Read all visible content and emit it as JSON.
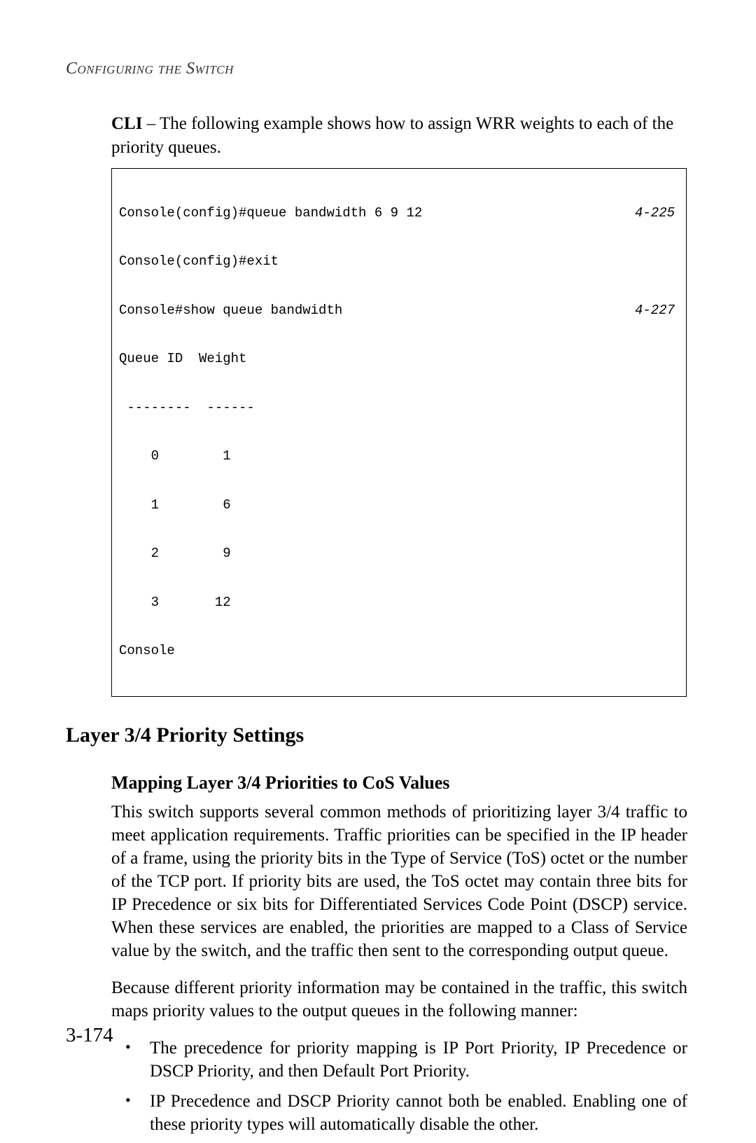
{
  "header": {
    "running_head": "Configuring the Switch"
  },
  "intro": {
    "lead": "CLI",
    "text": " – The following example shows how to assign WRR weights to each of the priority queues."
  },
  "code": {
    "line1_left": "Console(config)#queue bandwidth 6 9 12",
    "line1_ref": "4-225",
    "line2": "Console(config)#exit",
    "line3_left": "Console#show queue bandwidth",
    "line3_ref": "4-227",
    "line4": "Queue ID  Weight",
    "line5": " --------  ------",
    "line6": "    0        1",
    "line7": "    1        6",
    "line8": "    2        9",
    "line9": "    3       12",
    "line10": "Console"
  },
  "section": {
    "heading": "Layer 3/4 Priority Settings",
    "subheading": "Mapping Layer 3/4 Priorities to CoS Values",
    "para1": "This switch supports several common methods of prioritizing layer 3/4 traffic to meet application requirements. Traffic priorities can be specified in the IP header of a frame, using the priority bits in the Type of Service (ToS) octet or the number of the TCP port. If priority bits are used, the ToS octet may contain three bits for IP Precedence or six bits for Differentiated Services Code Point (DSCP) service. When these services are enabled, the priorities are mapped to a Class of Service value by the switch, and the traffic then sent to the corresponding output queue.",
    "para2": "Because different priority information may be contained in the traffic, this switch maps priority values to the output queues in the following manner:",
    "bullets": [
      "The precedence for priority mapping is IP Port Priority, IP Precedence or DSCP Priority, and then Default Port Priority.",
      "IP Precedence and DSCP Priority cannot both be enabled. Enabling one of these priority types will automatically disable the other."
    ]
  },
  "footer": {
    "page_number": "3-174"
  }
}
